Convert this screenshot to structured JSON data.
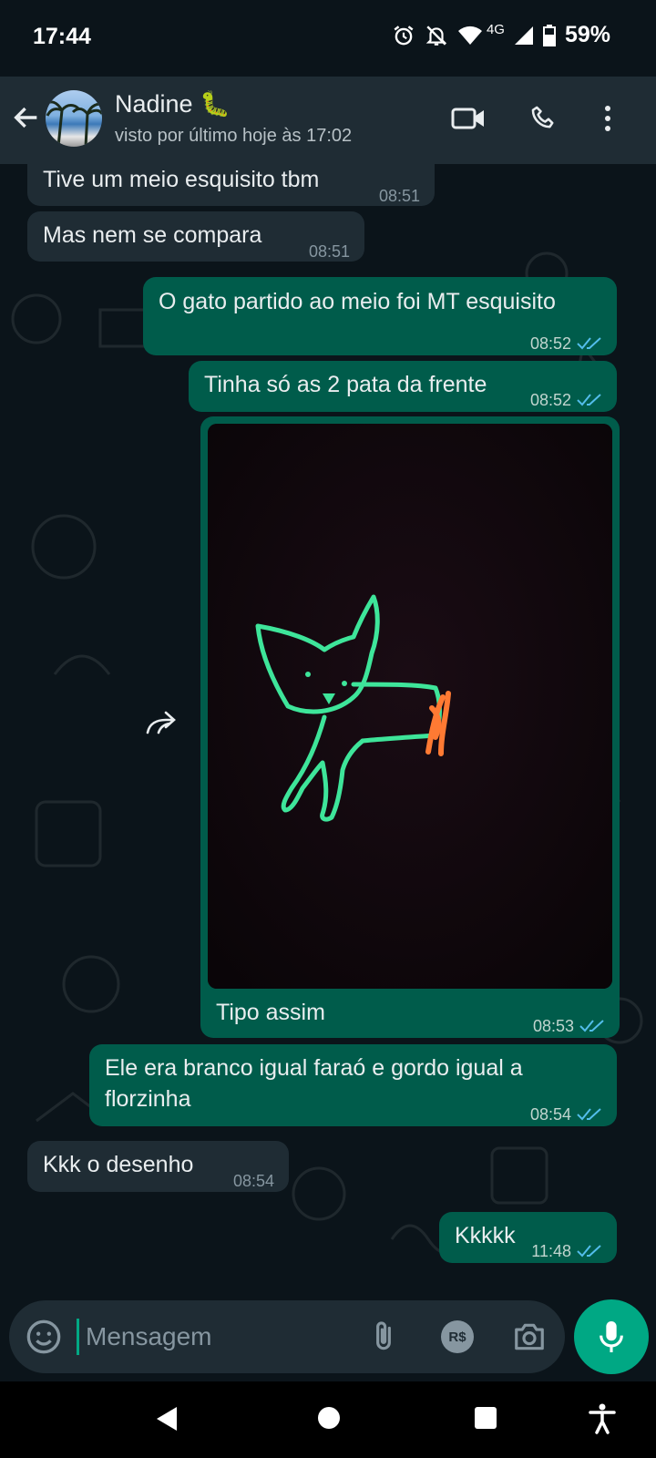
{
  "status_bar": {
    "time": "17:44",
    "network": "4G",
    "battery": "59%",
    "icons": [
      "alarm-icon",
      "muted-bell-icon",
      "wifi-icon",
      "cell-signal-icon",
      "battery-icon"
    ]
  },
  "header": {
    "contact_name": "Nadine 🐛",
    "contact_status": "visto por último hoje às 17:02",
    "icons": [
      "back-arrow-icon",
      "video-call-icon",
      "phone-icon",
      "more-vert-icon"
    ]
  },
  "messages": [
    {
      "dir": "in",
      "text": "Tive um meio esquisito tbm",
      "time": "08:51"
    },
    {
      "dir": "in",
      "text": "Mas nem se compara",
      "time": "08:51"
    },
    {
      "dir": "out",
      "text": "O gato partido ao meio foi MT esquisito",
      "time": "08:52",
      "read": true
    },
    {
      "dir": "out",
      "text": "Tinha só as 2 pata da frente",
      "time": "08:52",
      "read": true
    },
    {
      "dir": "out",
      "type": "image",
      "caption": "Tipo assim",
      "time": "08:53",
      "read": true
    },
    {
      "dir": "out",
      "text": "Ele era branco igual faraó e gordo igual a florzinha",
      "time": "08:54",
      "read": true
    },
    {
      "dir": "in",
      "text": "Kkk o desenho",
      "time": "08:54"
    },
    {
      "dir": "out",
      "text": "Kkkkk",
      "time": "11:48",
      "read": true
    }
  ],
  "composer": {
    "placeholder": "Mensagem",
    "currency_label": "R$"
  },
  "colors": {
    "background": "#0b141a",
    "incoming": "#1f2c34",
    "outgoing": "#005c4b",
    "accent": "#00a884",
    "read_ticks": "#53bdeb"
  }
}
